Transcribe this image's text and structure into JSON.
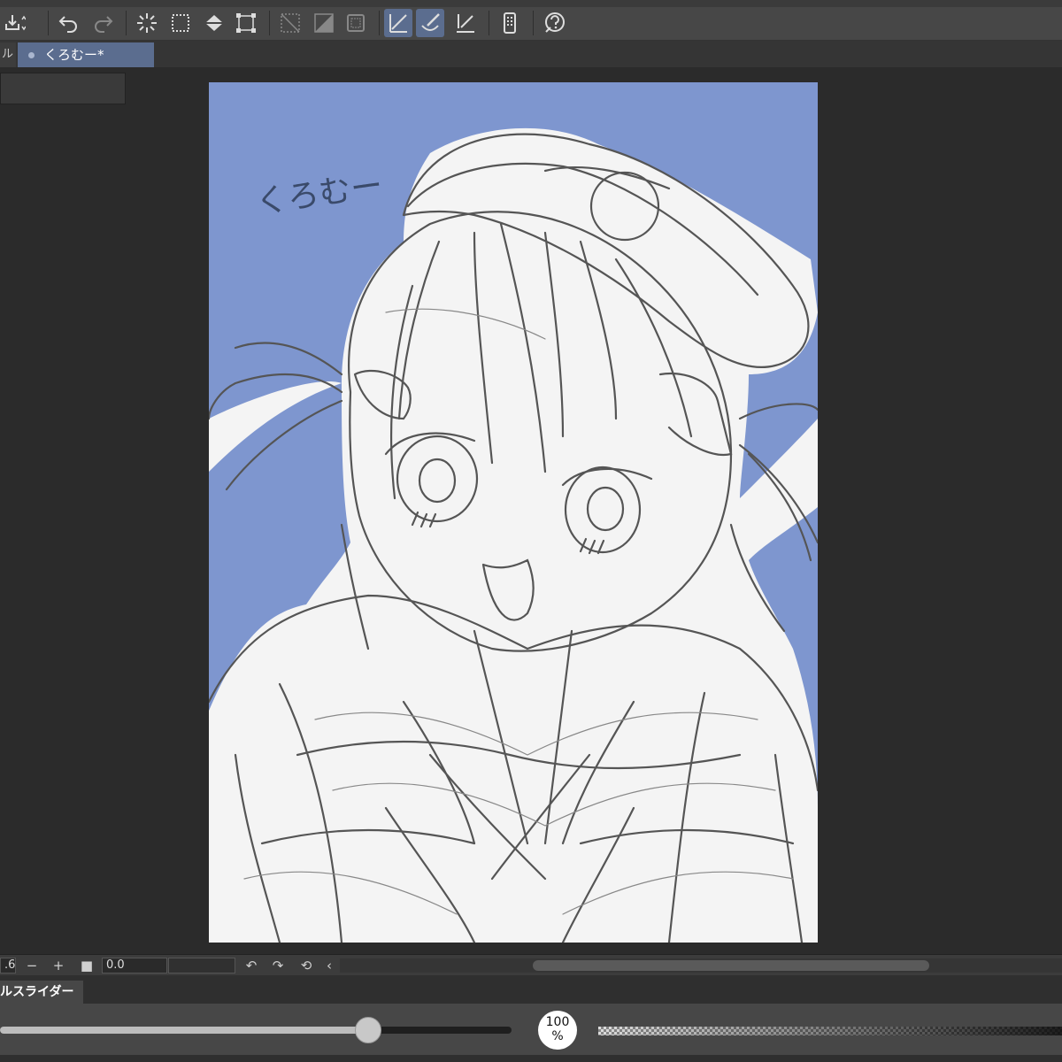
{
  "toolbar": {
    "buttons": [
      {
        "name": "export-icon"
      },
      {
        "name": "undo-icon"
      },
      {
        "name": "redo-icon"
      },
      {
        "name": "clear-selection-icon"
      },
      {
        "name": "select-all-icon"
      },
      {
        "name": "fill-icon"
      },
      {
        "name": "transform-icon"
      },
      {
        "name": "show-selection-icon"
      },
      {
        "name": "invert-selection-icon"
      },
      {
        "name": "selection-launcher-icon"
      },
      {
        "name": "pen-ruler-icon",
        "active": true
      },
      {
        "name": "brush-ruler-icon",
        "active": true
      },
      {
        "name": "snap-ruler-icon"
      },
      {
        "name": "smartphone-icon"
      },
      {
        "name": "help-icon"
      }
    ]
  },
  "tabs": {
    "left_partial": "ル",
    "active_label": "くろむー*"
  },
  "artwork": {
    "handwritten_text": "くろむー"
  },
  "navigator": {
    "zoom_value": ".6",
    "zoom_minus": "−",
    "zoom_plus": "+",
    "rotation_value": "0.0",
    "prev_arrow": "‹"
  },
  "slider_panel": {
    "tab_label": "ルスライダー",
    "zoom_badge_value": "100",
    "zoom_badge_unit": "%",
    "size_level": 0.72,
    "opacity_percent": 100
  },
  "colors": {
    "canvas_bg": "#7e96cf",
    "figure_fill": "#f4f4f4",
    "active_accent": "#5b6d8f"
  }
}
